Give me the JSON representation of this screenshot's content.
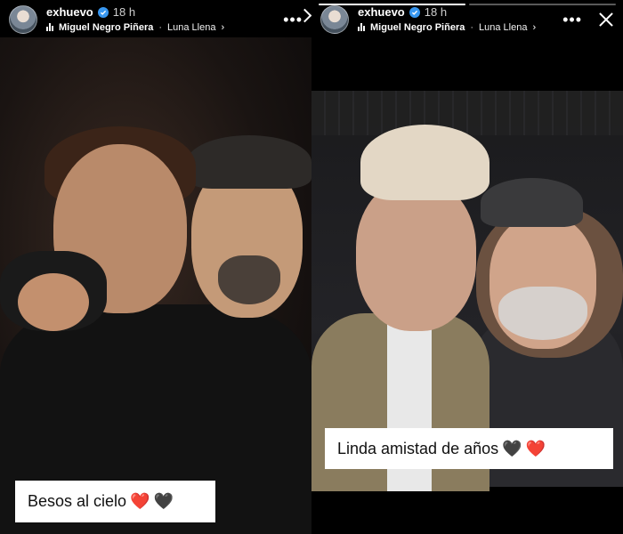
{
  "stories": [
    {
      "username": "exhuevo",
      "time": "18 h",
      "music_artist": "Miguel Negro Piñera",
      "music_separator": "·",
      "music_song": "Luna Llena",
      "caption_text": "Besos al cielo",
      "caption_emojis": [
        "❤️",
        "🖤"
      ]
    },
    {
      "username": "exhuevo",
      "time": "18 h",
      "music_artist": "Miguel Negro Piñera",
      "music_separator": "·",
      "music_song": "Luna Llena",
      "caption_text": "Linda amistad de años",
      "caption_emojis": [
        "🖤",
        "❤️"
      ]
    }
  ],
  "icons": {
    "verified": "verified-badge-icon",
    "music": "music-bars-icon",
    "more": "more-options-icon",
    "close": "close-icon",
    "next": "chevron-right-icon"
  },
  "colors": {
    "background": "#000000",
    "text": "#ffffff",
    "verified": "#3897f0",
    "heart_red": "#e02b2b",
    "caption_bg": "#ffffff"
  }
}
